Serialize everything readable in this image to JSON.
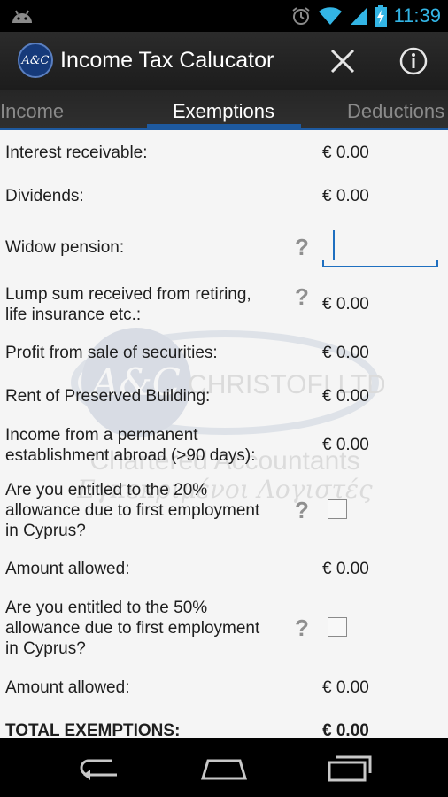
{
  "status_bar": {
    "time": "11:39",
    "icons": [
      "android-icon",
      "alarm-icon",
      "wifi-icon",
      "signal-icon",
      "battery-charging-icon"
    ]
  },
  "app": {
    "logo_text": "A&C",
    "title": "Income Tax Calucator"
  },
  "tabs": [
    {
      "label": "Income",
      "selected": false
    },
    {
      "label": "Exemptions",
      "selected": true
    },
    {
      "label": "Deductions",
      "selected": false
    }
  ],
  "form": {
    "interest_receivable": {
      "label": "Interest receivable:",
      "value": "€ 0.00"
    },
    "dividends": {
      "label": "Dividends:",
      "value": "€ 0.00"
    },
    "widow_pension": {
      "label": "Widow pension:",
      "help": "?",
      "input_value": ""
    },
    "lump_sum": {
      "label1": "Lump sum received from retiring,",
      "label2": "life insurance etc.:",
      "help": "?",
      "value": "€ 0.00"
    },
    "profit_securities": {
      "label": "Profit from sale of securities:",
      "value": "€ 0.00"
    },
    "rent_preserved": {
      "label": "Rent of Preserved Building:",
      "value": "€ 0.00"
    },
    "permanent_establishment": {
      "label1": "Income from a permanent",
      "label2": "establishment abroad (>90 days):",
      "value": "€ 0.00"
    },
    "allowance_20": {
      "label1": "Are you entitled to the 20%",
      "label2": "allowance due to first employment",
      "label3": "in Cyprus?",
      "help": "?",
      "checked": false
    },
    "amount_allowed_20": {
      "label": "Amount allowed:",
      "value": "€ 0.00"
    },
    "allowance_50": {
      "label1": "Are you entitled to the 50%",
      "label2": "allowance due to first employment",
      "label3": "in Cyprus?",
      "help": "?",
      "checked": false
    },
    "amount_allowed_50": {
      "label": "Amount allowed:",
      "value": "€ 0.00"
    },
    "total": {
      "label": "TOTAL EXEMPTIONS:",
      "value": "€ 0.00"
    }
  },
  "watermark": {
    "logo_text": "A&C",
    "name": "CHRISTOFI LTD",
    "line1": "Chartered Accountants",
    "line2": "Εγκεκριμένοι Λογιστές"
  },
  "colors": {
    "accent": "#1e6fc0",
    "tab_indicator": "#1e5aa0",
    "status_time": "#33b5e5"
  }
}
